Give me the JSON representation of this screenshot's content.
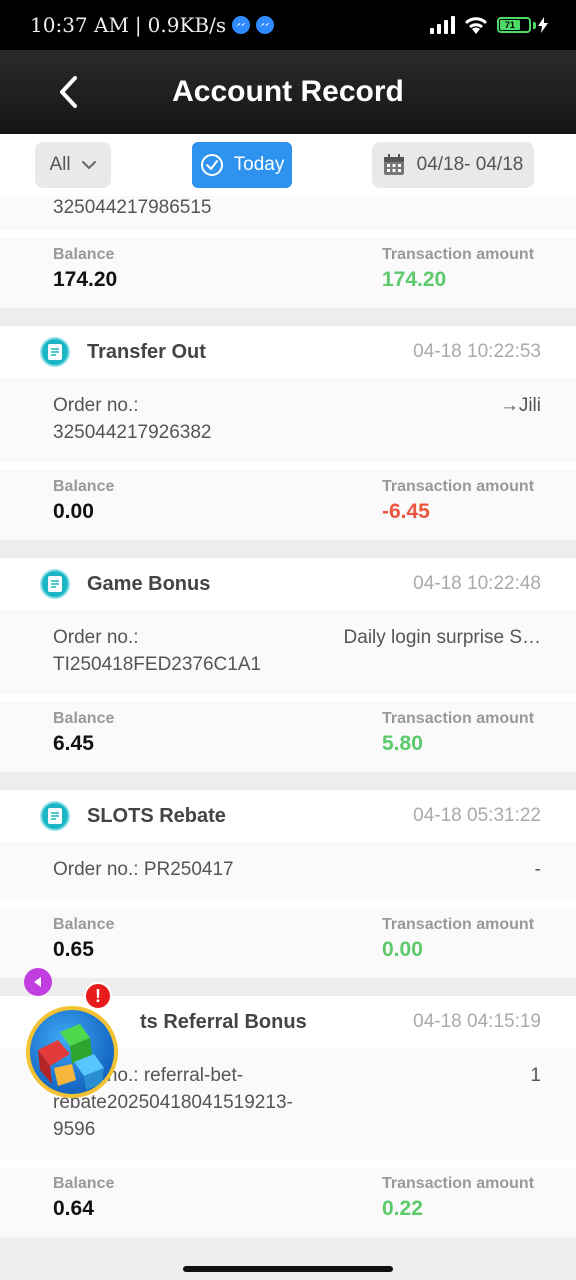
{
  "status_bar": {
    "time": "10:37 AM",
    "separator": "|",
    "speed": "0.9KB/s",
    "battery_level": "71"
  },
  "header": {
    "title": "Account Record"
  },
  "filters": {
    "all_label": "All",
    "today_label": "Today",
    "date_range": "04/18- 04/18"
  },
  "partial_record": {
    "order_no": "325044217986515",
    "balance_label": "Balance",
    "balance": "174.20",
    "amount_label": "Transaction amount",
    "amount": "174.20"
  },
  "records": [
    {
      "type": "Transfer Out",
      "time": "04-18 10:22:53",
      "order_label": "Order no.:",
      "order_no": "325044217926382",
      "detail": "→Jili",
      "balance_label": "Balance",
      "balance": "0.00",
      "amount_label": "Transaction amount",
      "amount": "-6.45"
    },
    {
      "type": "Game Bonus",
      "time": "04-18 10:22:48",
      "order_label": "Order no.:",
      "order_no": "TI250418FED2376C1A1",
      "detail": "Daily login surprise S…",
      "balance_label": "Balance",
      "balance": "6.45",
      "amount_label": "Transaction amount",
      "amount": "5.80"
    },
    {
      "type": "SLOTS Rebate",
      "time": "04-18 05:31:22",
      "order_label": "Order no.: PR250417",
      "detail": "-",
      "balance_label": "Balance",
      "balance": "0.65",
      "amount_label": "Transaction amount",
      "amount": "0.00"
    },
    {
      "type": "Slots Referral Bonus",
      "type_visible": "ts Referral Bonus",
      "time": "04-18 04:15:19",
      "order_label": "Order no.: referral-bet-",
      "order_no_line2": "rebate20250418041519213-",
      "order_no_line3": "9596",
      "detail": "1",
      "balance_label": "Balance",
      "balance": "0.64",
      "amount_label": "Transaction amount",
      "amount": "0.22"
    }
  ],
  "floating": {
    "alert": "!"
  },
  "colors": {
    "accent_blue": "#2d93ee",
    "positive_green": "#5cc96b",
    "negative_red": "#e9563c",
    "record_icon": "#1bb5c4"
  }
}
